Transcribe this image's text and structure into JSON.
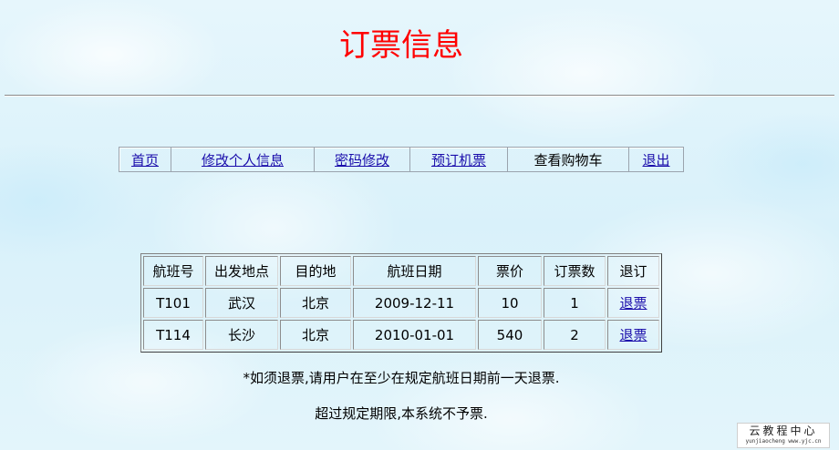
{
  "page": {
    "title": "订票信息"
  },
  "nav": {
    "items": [
      {
        "label": "首页",
        "link": true
      },
      {
        "label": "修改个人信息",
        "link": true
      },
      {
        "label": "密码修改",
        "link": true
      },
      {
        "label": "预订机票",
        "link": true
      },
      {
        "label": "查看购物车",
        "link": false
      },
      {
        "label": "退出",
        "link": true
      }
    ]
  },
  "table": {
    "headers": [
      "航班号",
      "出发地点",
      "目的地",
      "航班日期",
      "票价",
      "订票数",
      "退订"
    ],
    "rows": [
      {
        "flight": "T101",
        "from": "武汉",
        "to": "北京",
        "date": "2009-12-11",
        "price": "10",
        "count": "1",
        "action": "退票"
      },
      {
        "flight": "T114",
        "from": "长沙",
        "to": "北京",
        "date": "2010-01-01",
        "price": "540",
        "count": "2",
        "action": "退票"
      }
    ]
  },
  "notices": {
    "line1": "*如须退票,请用户在至少在规定航班日期前一天退票.",
    "line2": "超过规定期限,本系统不予票."
  },
  "watermark": {
    "title": "云教程中心",
    "subtitle": "yunjiaocheng  www.yjc.cn"
  }
}
